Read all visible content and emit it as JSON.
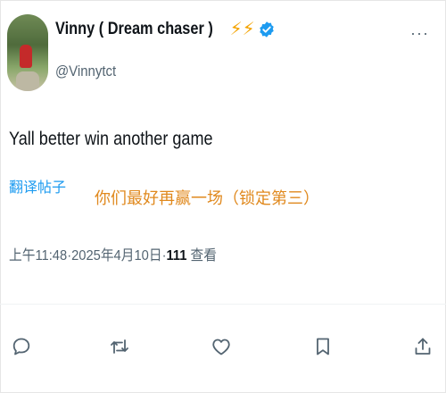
{
  "tweet": {
    "author": {
      "display_name": "Vinny ( Dream chaser )",
      "emoji": "⚡⚡",
      "handle": "@Vinnytct",
      "avatar": "avatar",
      "verified_icon": "verified-badge-icon"
    },
    "more_icon": "more-options-icon",
    "text": "Yall better win another game",
    "translate_label": "翻译帖子",
    "translation": "你们最好再赢一场（锁定第三）",
    "meta": {
      "time": "上午11:48",
      "separator": "·",
      "date": "2025年4月10日",
      "views_count": "111",
      "views_label": "查看"
    },
    "actions": [
      {
        "name": "reply",
        "icon": "reply-icon"
      },
      {
        "name": "retweet",
        "icon": "retweet-icon"
      },
      {
        "name": "like",
        "icon": "heart-icon"
      },
      {
        "name": "bookmark",
        "icon": "bookmark-icon"
      },
      {
        "name": "share",
        "icon": "share-icon"
      }
    ]
  },
  "colors": {
    "accent": "#1d9bf0",
    "muted": "#536471",
    "text": "#0f1419",
    "translation": "#e0891e",
    "bolt": "#f4a300"
  }
}
